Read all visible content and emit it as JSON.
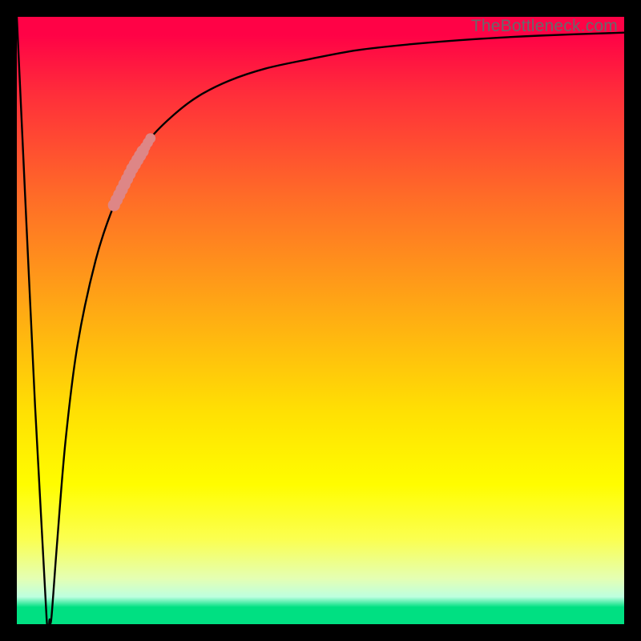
{
  "watermark": "TheBottleneck.com",
  "colors": {
    "frame": "#000000",
    "curve": "#000000",
    "highlight": "#de8686",
    "gradient_top": "#ff0246",
    "gradient_bottom": "#00e082"
  },
  "chart_data": {
    "type": "line",
    "title": "",
    "xlabel": "",
    "ylabel": "",
    "xlim": [
      0,
      100
    ],
    "ylim": [
      0,
      100
    ],
    "series": [
      {
        "name": "bottleneck-curve",
        "x": [
          0,
          3,
          4.9,
          5.4,
          5.7,
          6.6,
          8,
          10,
          13,
          16,
          19,
          22,
          26,
          30,
          35,
          41,
          48,
          56,
          65,
          75,
          86,
          100
        ],
        "values": [
          100,
          36,
          1.0,
          0.8,
          1.1,
          13,
          30,
          46,
          60,
          69,
          75,
          80,
          84,
          87,
          89.5,
          91.5,
          93,
          94.5,
          95.5,
          96.3,
          96.9,
          97.4
        ]
      }
    ],
    "annotations": [
      {
        "name": "highlighted-segment",
        "x_range": [
          16,
          22
        ],
        "style": "thick-pink-dots"
      }
    ],
    "grid": false,
    "legend": false
  }
}
